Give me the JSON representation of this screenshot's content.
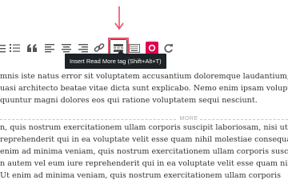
{
  "editor": {
    "toolbar": {
      "icons": [
        "bulleted-list",
        "numbered-list",
        "blockquote",
        "align-left",
        "align-center",
        "align-right",
        "insert-link",
        "insert-read-more",
        "toolbar-toggle",
        "record",
        "refresh"
      ],
      "tooltip": "Insert Read More tag (Shift+Alt+T)"
    },
    "content": {
      "paragraph1": [
        "mnis iste natus error sit voluptatem accusantium doloremque laudantium, to",
        "uasi architecto beatae vitae dicta sunt explicabo. Nemo enim ipsam voluptat",
        "quuntur magni dolores eos qui ratione voluptatem sequi nesciunt."
      ],
      "more_label": "MORE",
      "paragraph2": [
        "n, quis nostrum exercitationem ullam corporis suscipit laboriosam, nisi ut al",
        "reprehenderit qui in ea voluptate velit esse quam nihil molestiae consequatu",
        "enim ad minima veniam, quis nostrum exercitationem ullam corporis suscipit",
        "n autem vel eum iure reprehenderit qui in ea voluptate velit esse quam nihil",
        "Ut enim ad minima veniam, quis nostrum exercitationem ullam corporis"
      ]
    },
    "colors": {
      "highlight": "#e94f6a",
      "tooltip_bg": "#1d2327",
      "text": "#333333",
      "record": "#e0004d"
    }
  }
}
